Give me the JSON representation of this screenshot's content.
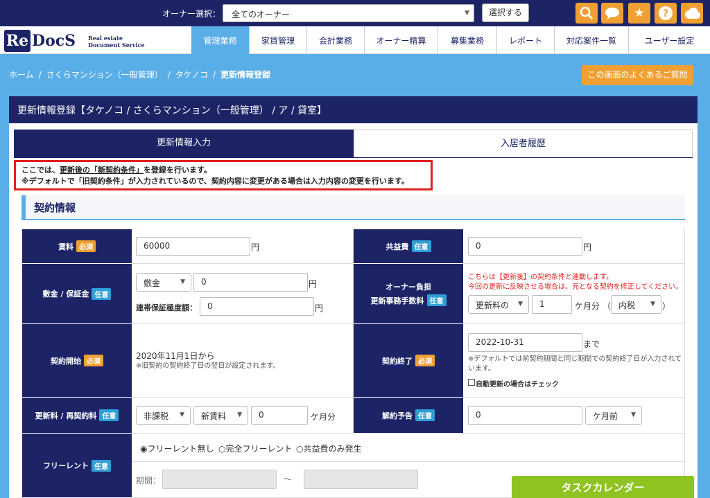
{
  "topbar": {
    "owner_label": "オーナー選択：",
    "owner_select_value": "全てのオーナー",
    "select_button": "選択する",
    "icons": [
      "search-icon",
      "chat-icon",
      "star-icon",
      "help-icon",
      "cloud-icon"
    ]
  },
  "logo": {
    "re": "Re",
    "docs": "DocS",
    "sub1": "Real estate",
    "sub2": "Document Service"
  },
  "nav": [
    {
      "label": "管理業務",
      "active": true
    },
    {
      "label": "家賃管理"
    },
    {
      "label": "会計業務"
    },
    {
      "label": "オーナー精算"
    },
    {
      "label": "募集業務"
    },
    {
      "label": "レポート"
    },
    {
      "label": "対応案件一覧"
    },
    {
      "label": "ユーザー設定"
    }
  ],
  "breadcrumb": [
    "ホーム",
    "さくらマンション（一般管理）",
    "タケノコ",
    "更新情報登録"
  ],
  "faq_button": "この画面のよくあるご質問",
  "panel_title": "更新情報登録【タケノコ / さくらマンション（一般管理） / ア / 貸室】",
  "tabs": [
    "更新情報入力",
    "入居者履歴"
  ],
  "notice": {
    "line1_pre": "ここでは、",
    "line1_u": "更新後の「新契約条件」",
    "line1_post": "を登録を行います。",
    "line2": "※デフォルトで「旧契約条件」が入力されているので、契約内容に変更がある場合は入力内容の変更を行います。"
  },
  "section_title": "契約情報",
  "badges": {
    "required": "必須",
    "optional": "任意"
  },
  "form": {
    "rent": {
      "label": "賃料",
      "value": "60000",
      "unit": "円"
    },
    "common_fee": {
      "label": "共益費",
      "value": "0",
      "unit": "円"
    },
    "deposit": {
      "label": "敷金 / 保証金",
      "type": "敷金",
      "value": "0",
      "unit": "円",
      "guarantee_label": "連帯保証極度額：",
      "guarantee_value": "0",
      "guarantee_unit": "円"
    },
    "owner_fee": {
      "label1": "オーナー負担",
      "label2": "更新事務手数料",
      "note1": "こちらは【更新後】の契約条件と連動します。",
      "note2": "今回の更新に反映させる場合は、元となる契約を修正してください。",
      "basis": "更新料の",
      "months": "1",
      "months_unit": "ケ月分",
      "paren_open": "（",
      "tax": "内税",
      "paren_close": "）"
    },
    "start": {
      "label": "契約開始",
      "value": "2020年11月1日から",
      "note": "※旧契約の契約終了日の翌日が設定されます。"
    },
    "end": {
      "label": "契約終了",
      "value": "2022-10-31",
      "suffix": "まで",
      "note1": "※デフォルトでは前契約期間と同じ期間での契約終了日が入力されて",
      "note2": "います。",
      "auto_renew": "自動更新の場合はチェック"
    },
    "renewal_fee": {
      "label": "更新料 / 再契約料",
      "tax": "非課税",
      "basis": "新賃料",
      "value": "0",
      "unit": "ケ月分"
    },
    "notice_period": {
      "label": "解約予告",
      "value": "0",
      "unit": "ケ月前"
    },
    "free_rent": {
      "label": "フリーレント",
      "options": [
        "フリーレント無し",
        "完全フリーレント",
        "共益費のみ発生"
      ],
      "selected": 0,
      "period_label": "期間：",
      "tilde": "〜"
    }
  },
  "task_button": "タスクカレンダー"
}
